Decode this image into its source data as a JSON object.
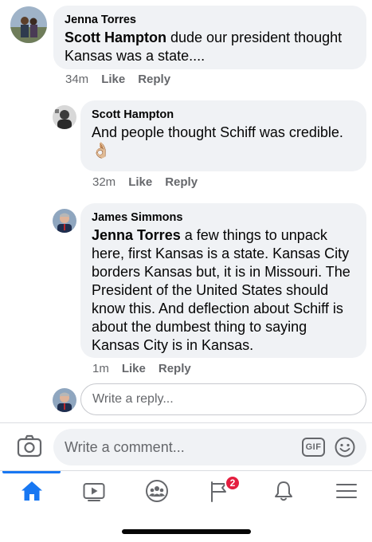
{
  "comments": [
    {
      "author": "Jenna Torres",
      "mention": "Scott Hampton",
      "text": " dude our president thought Kansas was a state....",
      "time": "34m",
      "like": "Like",
      "reply": "Reply"
    },
    {
      "author": "Scott Hampton",
      "text": "And people thought Schiff was credible.",
      "emoji": "👌🏼",
      "time": "32m",
      "like": "Like",
      "reply": "Reply"
    },
    {
      "author": "James Simmons",
      "mention": "Jenna Torres",
      "text": " a few things to unpack here, first Kansas is a state. Kansas City borders Kansas but, it is in Missouri. The President of the United States should know this.  And deflection about Schiff is about the dumbest thing to saying Kansas City is in Kansas.",
      "time": "1m",
      "like": "Like",
      "reply": "Reply"
    }
  ],
  "reply_box": {
    "placeholder": "Write a reply..."
  },
  "comment_box": {
    "placeholder": "Write a comment...",
    "gif_label": "GIF"
  },
  "tabbar": {
    "active": "home",
    "items": [
      "home-icon",
      "watch-icon",
      "groups-icon",
      "pages-icon",
      "notifications-icon",
      "menu-icon"
    ],
    "badge_count": "2"
  },
  "colors": {
    "accent": "#1877f2",
    "badge": "#e41e3f",
    "bubble": "#f0f2f5",
    "muted": "#65676b"
  }
}
